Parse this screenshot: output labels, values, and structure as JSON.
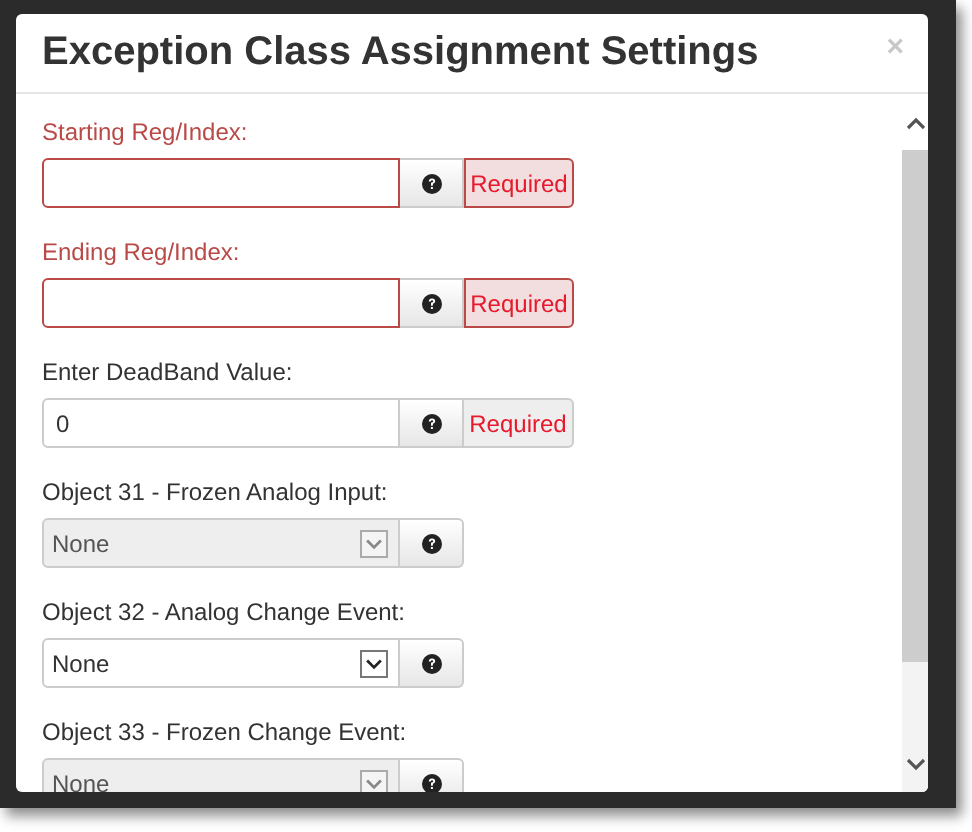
{
  "dialog": {
    "title": "Exception Class Assignment Settings",
    "close": "×"
  },
  "fields": [
    {
      "kind": "text",
      "label": "Starting Reg/Index:",
      "invalid": true,
      "addon": "Required"
    },
    {
      "kind": "text",
      "label": "Ending Reg/Index:",
      "invalid": true,
      "addon": "Required"
    },
    {
      "kind": "text",
      "label": "Enter DeadBand Value:",
      "value": "0",
      "invalid": false,
      "addon": "Required"
    },
    {
      "kind": "select",
      "label": "Object 31 - Frozen Analog Input:",
      "value": "None",
      "disabled": true
    },
    {
      "kind": "select",
      "label": "Object 32 - Analog Change Event:",
      "value": "None",
      "disabled": false
    },
    {
      "kind": "select",
      "label": "Object 33 - Frozen Change Event:",
      "value": "None",
      "disabled": true
    }
  ]
}
